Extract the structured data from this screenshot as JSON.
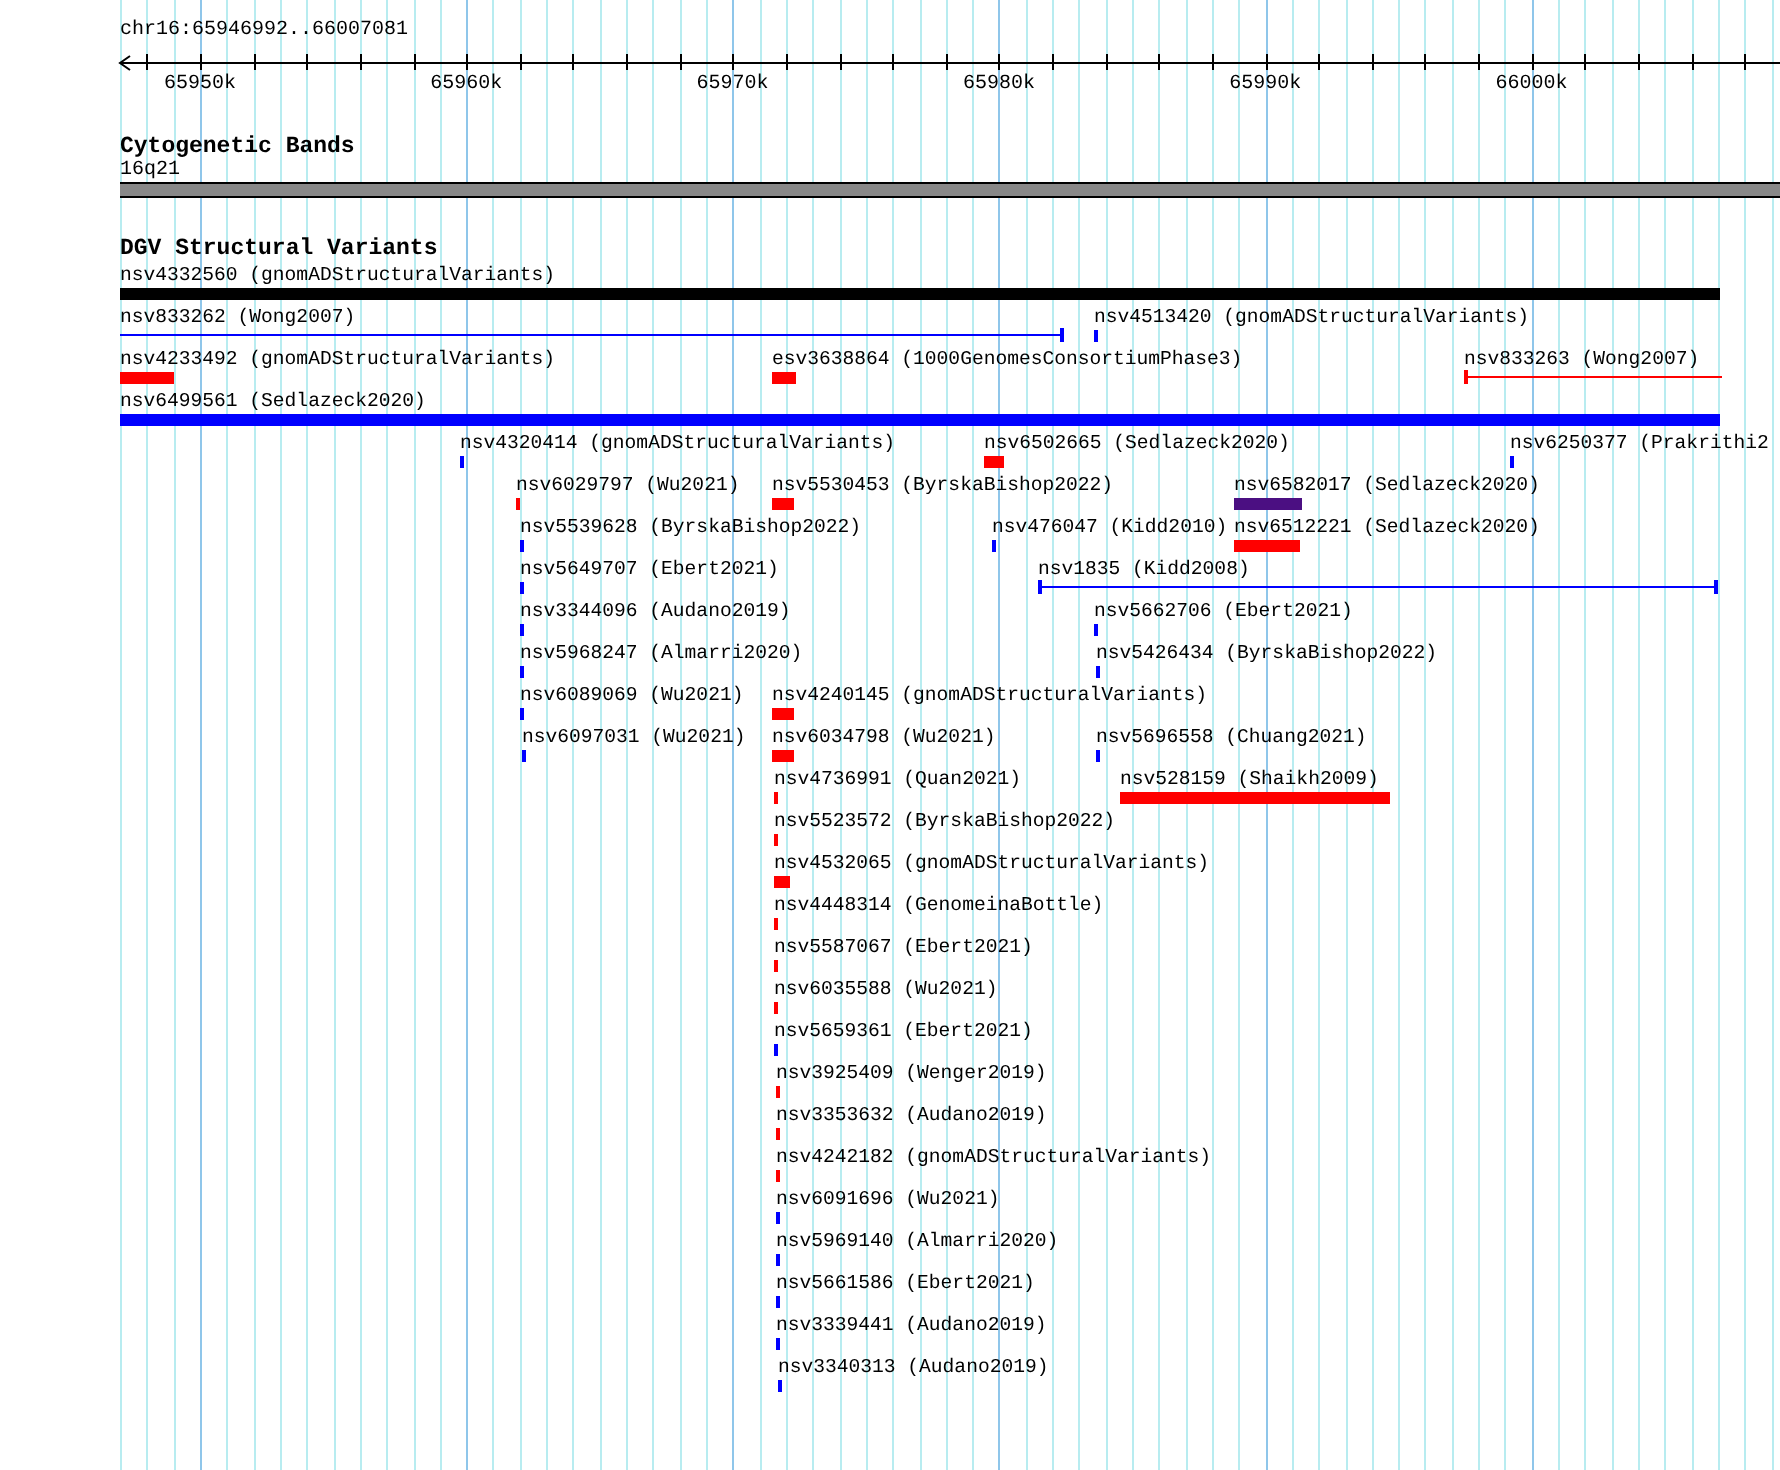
{
  "ruler": {
    "location": "chr16:65946992..66007081",
    "ticks": [
      {
        "label": "65950k"
      },
      {
        "label": "65960k"
      },
      {
        "label": "65970k"
      },
      {
        "label": "65980k"
      },
      {
        "label": "65990k"
      },
      {
        "label": "66000k"
      }
    ]
  },
  "tracks": [
    {
      "title": "Cytogenetic Bands",
      "kind": "bands",
      "bands": [
        {
          "label": "16q21"
        }
      ]
    },
    {
      "title": "DGV Structural Variants",
      "kind": "variants",
      "rows": [
        {
          "features": [
            {
              "label": "nsv4332560 (gnomADStructuralVariants)",
              "kind": "bar",
              "color": "#000000"
            }
          ]
        },
        {
          "features": [
            {
              "label": "nsv833262 (Wong2007)",
              "kind": "span",
              "color": "#0000ff"
            },
            {
              "label": "nsv4513420 (gnomADStructuralVariants)",
              "kind": "bar",
              "color": "#0000ff"
            }
          ]
        },
        {
          "features": [
            {
              "label": "nsv4233492 (gnomADStructuralVariants)",
              "kind": "bar",
              "color": "#ff0000"
            },
            {
              "label": "esv3638864 (1000GenomesConsortiumPhase3)",
              "kind": "bar",
              "color": "#ff0000"
            },
            {
              "label": "nsv833263 (Wong2007)",
              "kind": "span",
              "color": "#ff0000"
            }
          ]
        },
        {
          "features": [
            {
              "label": "nsv6499561 (Sedlazeck2020)",
              "kind": "bar",
              "color": "#0000ff"
            }
          ]
        },
        {
          "features": [
            {
              "label": "nsv4320414 (gnomADStructuralVariants)",
              "kind": "bar",
              "color": "#0000ff"
            },
            {
              "label": "nsv6502665 (Sedlazeck2020)",
              "kind": "bar",
              "color": "#ff0000"
            },
            {
              "label": "nsv6250377 (Prakrithi2",
              "kind": "bar",
              "color": "#0000ff"
            }
          ]
        },
        {
          "features": [
            {
              "label": "nsv6029797 (Wu2021)",
              "kind": "bar",
              "color": "#ff0000"
            },
            {
              "label": "nsv5530453 (ByrskaBishop2022)",
              "kind": "bar",
              "color": "#ff0000"
            },
            {
              "label": "nsv6582017 (Sedlazeck2020)",
              "kind": "bar",
              "color": "#4b0f82"
            }
          ]
        },
        {
          "features": [
            {
              "label": "nsv5539628 (ByrskaBishop2022)",
              "kind": "bar",
              "color": "#0000ff"
            },
            {
              "label": "nsv476047 (Kidd2010)",
              "kind": "bar",
              "color": "#0000ff"
            },
            {
              "label": "nsv6512221 (Sedlazeck2020)",
              "kind": "bar",
              "color": "#ff0000"
            }
          ]
        },
        {
          "features": [
            {
              "label": "nsv5649707 (Ebert2021)",
              "kind": "bar",
              "color": "#0000ff"
            },
            {
              "label": "nsv1835 (Kidd2008)",
              "kind": "span",
              "color": "#0000ff"
            }
          ]
        },
        {
          "features": [
            {
              "label": "nsv3344096 (Audano2019)",
              "kind": "bar",
              "color": "#0000ff"
            },
            {
              "label": "nsv5662706 (Ebert2021)",
              "kind": "bar",
              "color": "#0000ff"
            }
          ]
        },
        {
          "features": [
            {
              "label": "nsv5968247 (Almarri2020)",
              "kind": "bar",
              "color": "#0000ff"
            },
            {
              "label": "nsv5426434 (ByrskaBishop2022)",
              "kind": "bar",
              "color": "#0000ff"
            }
          ]
        },
        {
          "features": [
            {
              "label": "nsv6089069 (Wu2021)",
              "kind": "bar",
              "color": "#0000ff"
            },
            {
              "label": "nsv4240145 (gnomADStructuralVariants)",
              "kind": "bar",
              "color": "#ff0000"
            }
          ]
        },
        {
          "features": [
            {
              "label": "nsv6097031 (Wu2021)",
              "kind": "bar",
              "color": "#0000ff"
            },
            {
              "label": "nsv6034798 (Wu2021)",
              "kind": "bar",
              "color": "#ff0000"
            },
            {
              "label": "nsv5696558 (Chuang2021)",
              "kind": "bar",
              "color": "#0000ff"
            }
          ]
        },
        {
          "features": [
            {
              "label": "nsv4736991 (Quan2021)",
              "kind": "bar",
              "color": "#ff0000"
            },
            {
              "label": "nsv528159 (Shaikh2009)",
              "kind": "bar",
              "color": "#ff0000"
            }
          ]
        },
        {
          "features": [
            {
              "label": "nsv5523572 (ByrskaBishop2022)",
              "kind": "bar",
              "color": "#ff0000"
            }
          ]
        },
        {
          "features": [
            {
              "label": "nsv4532065 (gnomADStructuralVariants)",
              "kind": "bar",
              "color": "#ff0000"
            }
          ]
        },
        {
          "features": [
            {
              "label": "nsv4448314 (GenomeinaBottle)",
              "kind": "bar",
              "color": "#ff0000"
            }
          ]
        },
        {
          "features": [
            {
              "label": "nsv5587067 (Ebert2021)",
              "kind": "bar",
              "color": "#ff0000"
            }
          ]
        },
        {
          "features": [
            {
              "label": "nsv6035588 (Wu2021)",
              "kind": "bar",
              "color": "#ff0000"
            }
          ]
        },
        {
          "features": [
            {
              "label": "nsv5659361 (Ebert2021)",
              "kind": "bar",
              "color": "#0000ff"
            }
          ]
        },
        {
          "features": [
            {
              "label": "nsv3925409 (Wenger2019)",
              "kind": "bar",
              "color": "#ff0000"
            }
          ]
        },
        {
          "features": [
            {
              "label": "nsv3353632 (Audano2019)",
              "kind": "bar",
              "color": "#ff0000"
            }
          ]
        },
        {
          "features": [
            {
              "label": "nsv4242182 (gnomADStructuralVariants)",
              "kind": "bar",
              "color": "#ff0000"
            }
          ]
        },
        {
          "features": [
            {
              "label": "nsv6091696 (Wu2021)",
              "kind": "bar",
              "color": "#0000ff"
            }
          ]
        },
        {
          "features": [
            {
              "label": "nsv5969140 (Almarri2020)",
              "kind": "bar",
              "color": "#0000ff"
            }
          ]
        },
        {
          "features": [
            {
              "label": "nsv5661586 (Ebert2021)",
              "kind": "bar",
              "color": "#0000ff"
            }
          ]
        },
        {
          "features": [
            {
              "label": "nsv3339441 (Audano2019)",
              "kind": "bar",
              "color": "#0000ff"
            }
          ]
        },
        {
          "features": [
            {
              "label": "nsv3340313 (Audano2019)",
              "kind": "bar",
              "color": "#0000ff"
            }
          ]
        }
      ]
    }
  ]
}
